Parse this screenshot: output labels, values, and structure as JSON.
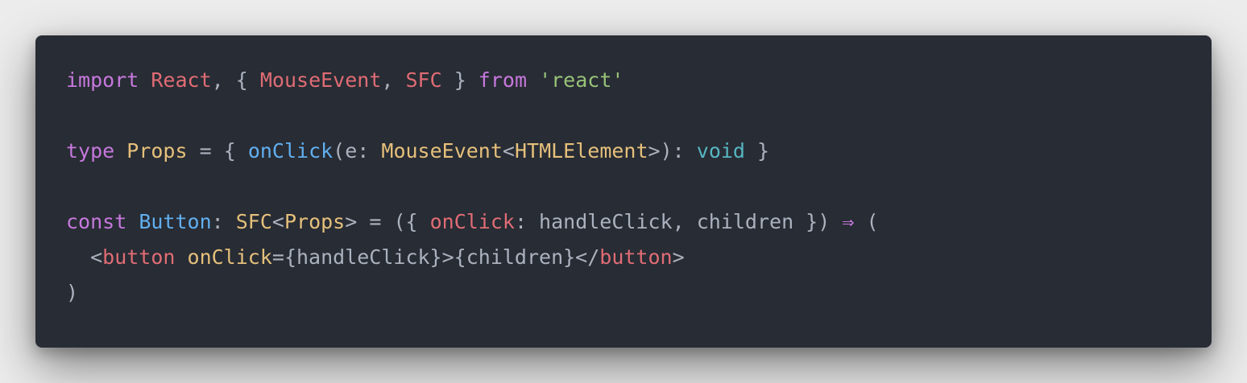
{
  "colors": {
    "background": "#ececec",
    "editor_bg": "#282c34",
    "keyword": "#c678dd",
    "variable": "#e06c75",
    "type": "#e5c07b",
    "function": "#61afef",
    "builtin": "#56b6c2",
    "string": "#98c379",
    "plain": "#abb2bf"
  },
  "code": {
    "lines": [
      [
        {
          "t": "import",
          "c": "kw"
        },
        {
          "t": " ",
          "c": "plain"
        },
        {
          "t": "React",
          "c": "red"
        },
        {
          "t": ", { ",
          "c": "plain"
        },
        {
          "t": "MouseEvent",
          "c": "red"
        },
        {
          "t": ", ",
          "c": "plain"
        },
        {
          "t": "SFC",
          "c": "red"
        },
        {
          "t": " } ",
          "c": "plain"
        },
        {
          "t": "from",
          "c": "kw"
        },
        {
          "t": " ",
          "c": "plain"
        },
        {
          "t": "'react'",
          "c": "green"
        }
      ],
      [],
      [
        {
          "t": "type",
          "c": "kw"
        },
        {
          "t": " ",
          "c": "plain"
        },
        {
          "t": "Props",
          "c": "yel"
        },
        {
          "t": " = { ",
          "c": "plain"
        },
        {
          "t": "onClick",
          "c": "blue"
        },
        {
          "t": "(e: ",
          "c": "plain"
        },
        {
          "t": "MouseEvent",
          "c": "yel"
        },
        {
          "t": "<",
          "c": "plain"
        },
        {
          "t": "HTMLElement",
          "c": "yel"
        },
        {
          "t": ">): ",
          "c": "plain"
        },
        {
          "t": "void",
          "c": "cyan"
        },
        {
          "t": " }",
          "c": "plain"
        }
      ],
      [],
      [
        {
          "t": "const",
          "c": "kw"
        },
        {
          "t": " ",
          "c": "plain"
        },
        {
          "t": "Button",
          "c": "blue"
        },
        {
          "t": ": ",
          "c": "plain"
        },
        {
          "t": "SFC",
          "c": "yel"
        },
        {
          "t": "<",
          "c": "plain"
        },
        {
          "t": "Props",
          "c": "yel"
        },
        {
          "t": "> = ({ ",
          "c": "plain"
        },
        {
          "t": "onClick",
          "c": "red"
        },
        {
          "t": ": handleClick, children }) ",
          "c": "plain"
        },
        {
          "t": "⇒",
          "c": "kw"
        },
        {
          "t": " (",
          "c": "plain"
        }
      ],
      [
        {
          "t": "  <",
          "c": "plain"
        },
        {
          "t": "button",
          "c": "red"
        },
        {
          "t": " ",
          "c": "plain"
        },
        {
          "t": "onClick",
          "c": "yel"
        },
        {
          "t": "={handleClick}>{children}</",
          "c": "plain"
        },
        {
          "t": "button",
          "c": "red"
        },
        {
          "t": ">",
          "c": "plain"
        }
      ],
      [
        {
          "t": ")",
          "c": "plain"
        }
      ]
    ]
  }
}
